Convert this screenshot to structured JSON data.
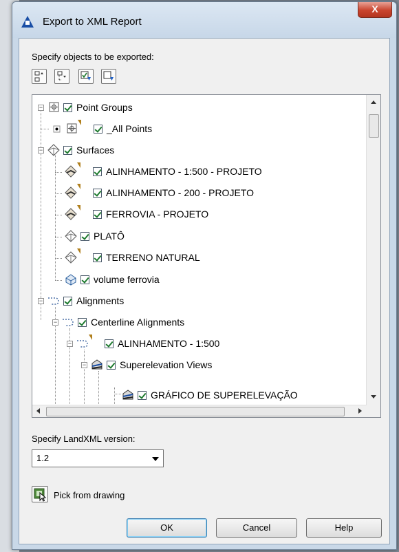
{
  "window": {
    "title": "Export to XML Report",
    "close_label": "X"
  },
  "labels": {
    "specify_objects": "Specify objects to be exported:",
    "specify_version": "Specify LandXML version:",
    "pick_from_drawing": "Pick from drawing"
  },
  "toolbar": {
    "icons": [
      "expand-all-icon",
      "collapse-all-icon",
      "select-all-icon",
      "clear-all-icon"
    ]
  },
  "tree": {
    "items": [
      {
        "label": "Point Groups",
        "icon": "point-groups-icon",
        "checked": true
      },
      {
        "label": "_All Points",
        "icon": "point-group-icon",
        "checked": true
      },
      {
        "label": "Surfaces",
        "icon": "surfaces-icon",
        "checked": true
      },
      {
        "label": "ALINHAMENTO - 1:500 - PROJETO",
        "icon": "surface-icon",
        "checked": true
      },
      {
        "label": "ALINHAMENTO - 200 - PROJETO",
        "icon": "surface-icon",
        "checked": true
      },
      {
        "label": "FERROVIA - PROJETO",
        "icon": "surface-icon",
        "checked": true
      },
      {
        "label": "PLATÔ",
        "icon": "surface-icon",
        "checked": true
      },
      {
        "label": "TERRENO NATURAL",
        "icon": "surface-icon",
        "checked": true
      },
      {
        "label": "volume ferrovia",
        "icon": "volume-surface-icon",
        "checked": true
      },
      {
        "label": "Alignments",
        "icon": "alignments-icon",
        "checked": true
      },
      {
        "label": "Centerline Alignments",
        "icon": "alignment-icon",
        "checked": true
      },
      {
        "label": "ALINHAMENTO - 1:500",
        "icon": "alignment-icon",
        "checked": true
      },
      {
        "label": "Superelevation Views",
        "icon": "superelevation-views-icon",
        "checked": true
      },
      {
        "label": "GRÁFICO DE SUPERELEVAÇÃO",
        "icon": "superelevation-view-icon",
        "checked": true
      }
    ]
  },
  "version_select": {
    "value": "1.2"
  },
  "buttons": {
    "ok": "OK",
    "cancel": "Cancel",
    "help": "Help"
  },
  "colors": {
    "title_bar": "#c7d7e8",
    "close_button": "#c9442e",
    "dialog_bg": "#f0f0f0",
    "check": "#1d7a2e"
  }
}
